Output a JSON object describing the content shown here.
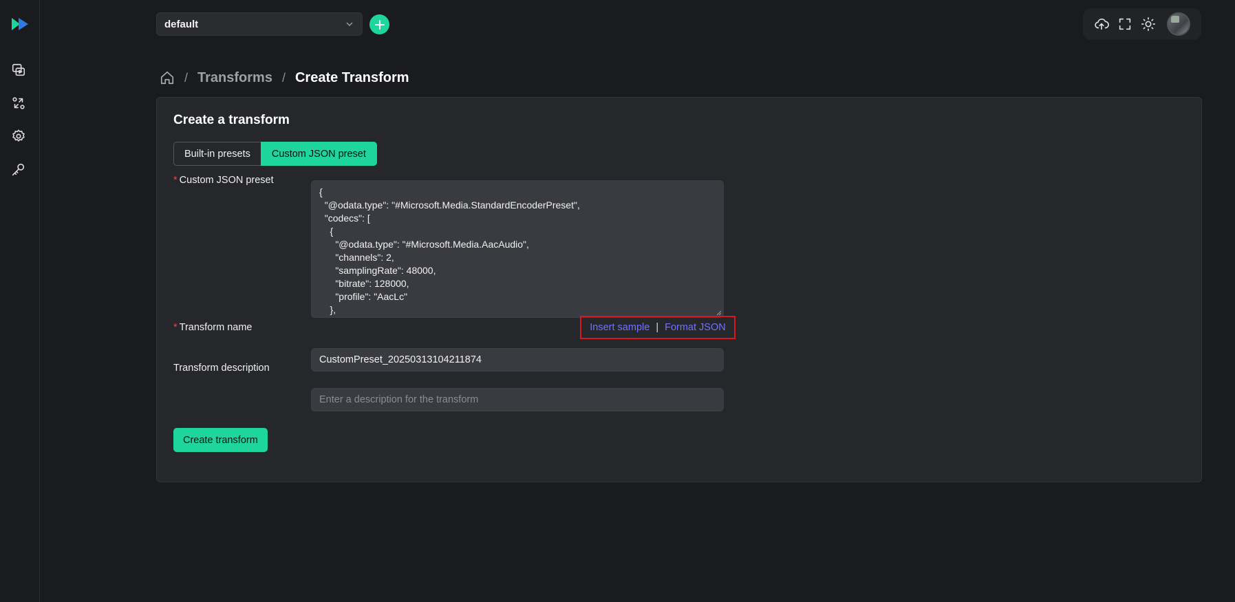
{
  "header": {
    "environment": "default",
    "add_label": "+"
  },
  "breadcrumb": {
    "sep1": "/",
    "transforms": "Transforms",
    "sep2": "/",
    "current": "Create Transform"
  },
  "card": {
    "title": "Create a transform",
    "tabs": {
      "builtin": "Built-in presets",
      "custom": "Custom JSON preset"
    },
    "json_label": "Custom JSON preset",
    "json_value": "{\n  \"@odata.type\": \"#Microsoft.Media.StandardEncoderPreset\",\n  \"codecs\": [\n    {\n      \"@odata.type\": \"#Microsoft.Media.AacAudio\",\n      \"channels\": 2,\n      \"samplingRate\": 48000,\n      \"bitrate\": 128000,\n      \"profile\": \"AacLc\"\n    },\n    {",
    "insert_sample": "Insert sample",
    "divider": "|",
    "format_json": "Format JSON",
    "name_label": "Transform name",
    "name_value": "CustomPreset_20250313104211874",
    "desc_label": "Transform description",
    "desc_placeholder": "Enter a description for the transform",
    "create_button": "Create transform",
    "required_mark": "*"
  },
  "colors": {
    "accent": "#1ed69a",
    "link": "#6f73ff",
    "highlight_box": "#e0141b"
  },
  "icons": {
    "logo": "play-logo-icon",
    "nav": [
      "media-library-icon",
      "transforms-icon",
      "settings-gear-icon",
      "api-key-icon"
    ],
    "toolbar": [
      "upload-cloud-icon",
      "fullscreen-icon",
      "theme-sun-icon"
    ]
  }
}
